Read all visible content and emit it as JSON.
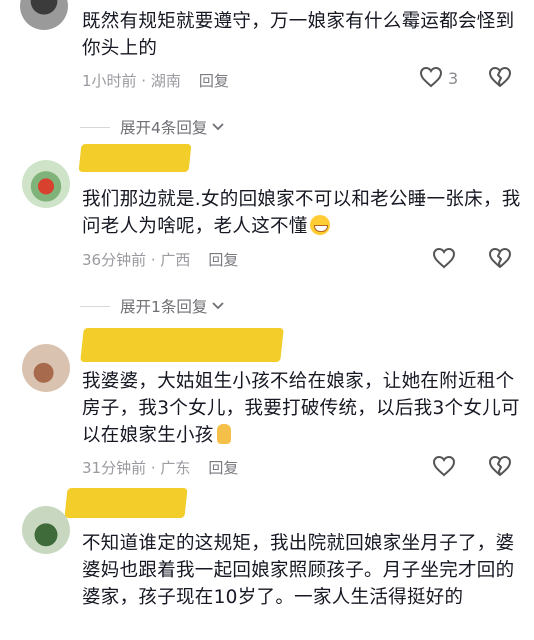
{
  "comments": [
    {
      "text": "既然有规矩就要遵守，万一娘家有什么霉运都会怪到你头上的",
      "time": "1小时前 · 湖南",
      "reply": "回复",
      "likes": "3"
    },
    {
      "text": "我们那边就是.女的回娘家不可以和老公睡一张床，我问老人为啥呢，老人这不懂",
      "time": "36分钟前 · 广西",
      "reply": "回复",
      "likes": ""
    },
    {
      "text": "我婆婆，大姑姐生小孩不给在娘家，让她在附近租个房子，我3个女儿，我要打破传统，以后我3个女儿可以在娘家生小孩",
      "time": "31分钟前 · 广东",
      "reply": "回复",
      "likes": ""
    },
    {
      "text": "不知道谁定的这规矩，我出院就回娘家坐月子了，婆婆妈也跟着我一起回娘家照顾孩子。月子坐完才回的婆家，孩子现在10岁了。一家人生活得挺好的",
      "time": "",
      "reply": "",
      "likes": ""
    }
  ],
  "expand_1": "展开4条回复",
  "expand_2": "展开1条回复",
  "colors": {
    "mask": "#f3cd2a",
    "meta": "#9a9aa0"
  },
  "icons": [
    "heart-icon",
    "broken-heart-icon",
    "chevron-down-icon",
    "grin-emoji-icon",
    "hand-emoji-icon"
  ]
}
